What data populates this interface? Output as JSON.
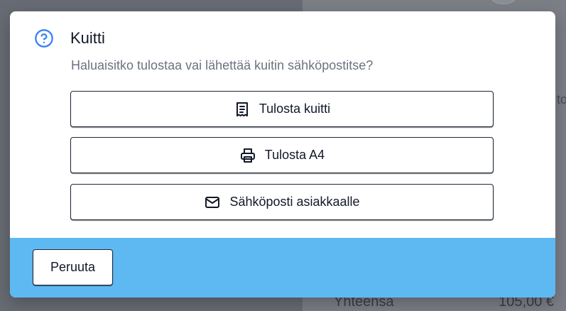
{
  "background": {
    "partial_text": "to",
    "total_label": "Yhteensä",
    "total_value": "105,00 €"
  },
  "modal": {
    "title": "Kuitti",
    "subtitle": "Haluaisitko tulostaa vai lähettää kuitin sähköpostitse?",
    "options": [
      {
        "label": "Tulosta kuitti",
        "icon": "receipt-icon"
      },
      {
        "label": "Tulosta A4",
        "icon": "printer-icon"
      },
      {
        "label": "Sähköposti asiakkaalle",
        "icon": "mail-icon"
      }
    ],
    "cancel_label": "Peruuta"
  },
  "colors": {
    "accent_blue": "#3b82f6",
    "footer_bg": "#5eb9f3",
    "text_primary": "#111827",
    "text_muted": "#6b7280"
  }
}
